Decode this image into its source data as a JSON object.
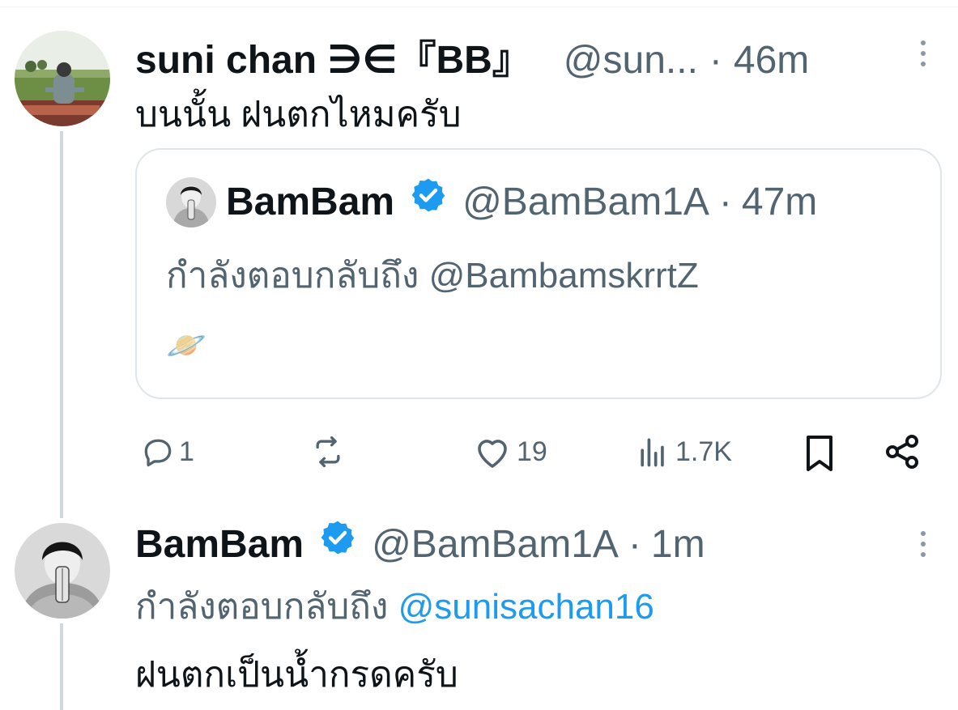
{
  "post1": {
    "author_name": "suni chan ∋∈『BB』",
    "handle": "@sun...",
    "time_sep": "·",
    "time": "46m",
    "text": "บนนั้น ฝนตกไหมครับ",
    "quote": {
      "author_name": "BamBam",
      "handle": "@BamBam1A",
      "time_sep": "·",
      "time": "47m",
      "reply_prefix": "กำลังตอบกลับถึง",
      "reply_to": "@BambamskrrtZ",
      "emoji": "🪐"
    },
    "actions": {
      "replies": "1",
      "reposts": "",
      "likes": "19",
      "views": "1.7K"
    }
  },
  "post2": {
    "author_name": "BamBam",
    "handle": "@BamBam1A",
    "time_sep": "·",
    "time": "1m",
    "reply_prefix": "กำลังตอบกลับถึง",
    "reply_to": "@sunisachan16",
    "text": "ฝนตกเป็นน้ำกรดครับ"
  },
  "colors": {
    "accent": "#1d9bf0",
    "muted": "#536471",
    "thread_line": "#cfd9de"
  }
}
